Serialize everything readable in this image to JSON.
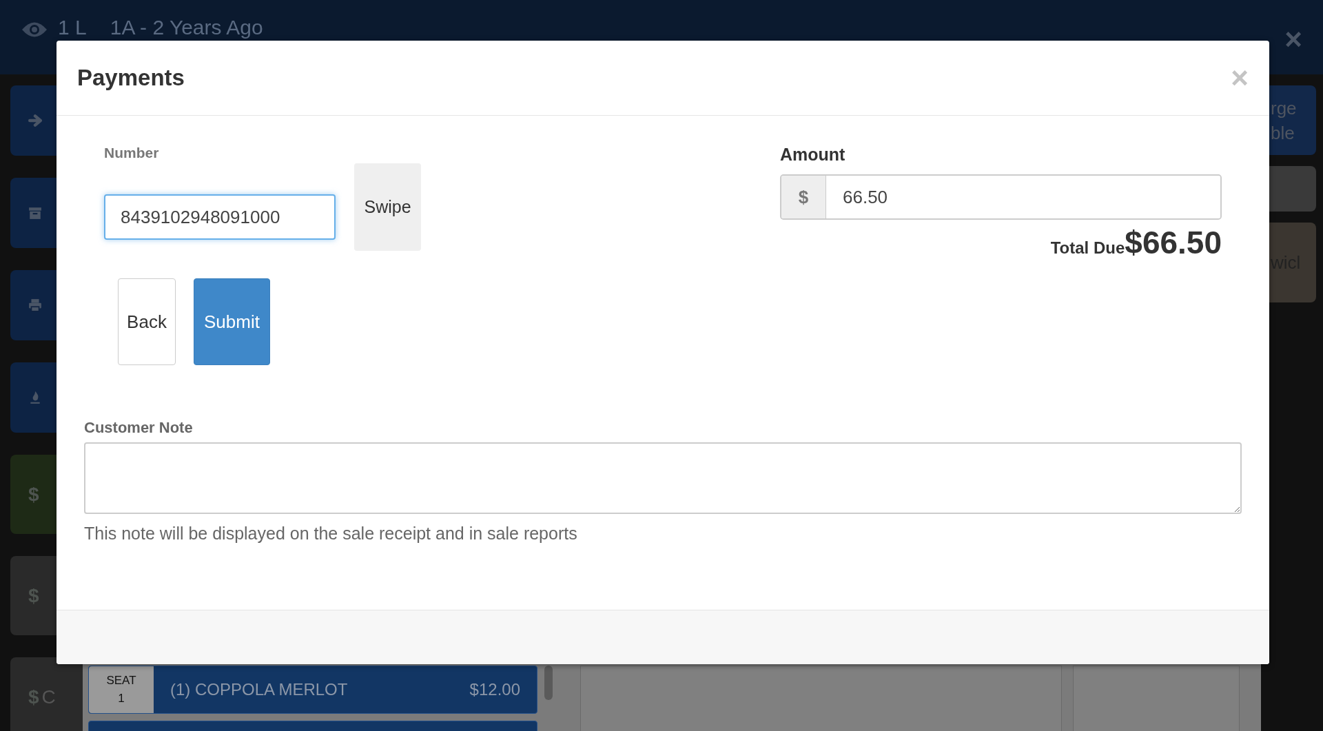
{
  "top_bar": {
    "title_parts": [
      "1 L",
      "1A - 2 Years Ago"
    ],
    "close": "×"
  },
  "left_buttons": [
    {
      "kind": "forward"
    },
    {
      "kind": "archive"
    },
    {
      "kind": "print"
    },
    {
      "kind": "fire"
    },
    {
      "kind": "payment",
      "symbol": "$"
    },
    {
      "kind": "cash",
      "symbol": "$"
    },
    {
      "kind": "cash",
      "symbol": "$",
      "label": "C"
    }
  ],
  "right_buttons": [
    {
      "kind": "charge",
      "lines": [
        "rge",
        "ble"
      ]
    },
    {
      "kind": "blank"
    },
    {
      "kind": "item",
      "lines": [
        "wicl"
      ]
    }
  ],
  "order_rows": [
    {
      "seat_label": "SEAT",
      "seat_number": "1",
      "name": "(1) COPPOLA MERLOT",
      "price": "$12.00"
    }
  ],
  "more_rows_below": true,
  "modal": {
    "title": "Payments",
    "close": "×",
    "number": {
      "label": "Number",
      "value": "8439102948091000",
      "focused": true
    },
    "swipe": "Swipe",
    "buttons": [
      {
        "label": "Back",
        "kind": "default"
      },
      {
        "label": "Submit",
        "kind": "primary"
      }
    ],
    "amount": {
      "label": "Amount",
      "addon": "$",
      "value": "66.50"
    },
    "total": {
      "label": "Total Due",
      "value": "$66.50"
    },
    "note": {
      "label": "Customer Note",
      "help": "This note will be displayed on the sale receipt and in sale reports"
    }
  }
}
